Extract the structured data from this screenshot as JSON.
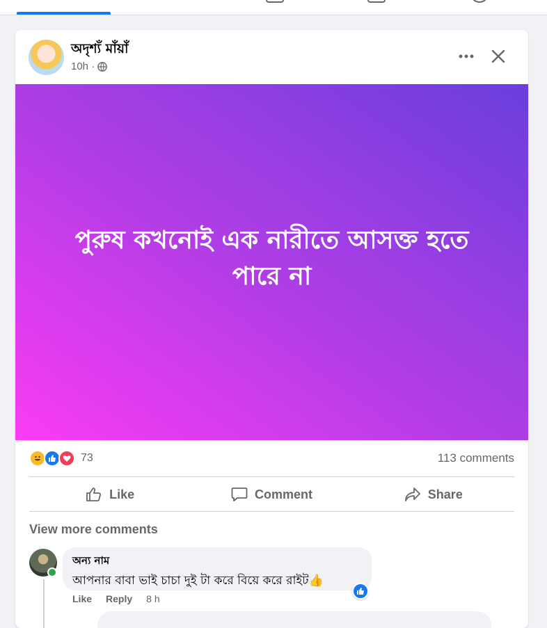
{
  "post": {
    "author": "অদৃশ্যঁ মাঁয়াঁ",
    "time": "10h ·",
    "privacy_icon": "globe-icon",
    "body_text": "পুরুষ কখনোই এক নারীতে আসক্ত হতে পারে না",
    "background": {
      "from": "#fb3cf4",
      "to": "#6a3fdc"
    }
  },
  "reactions": {
    "types": [
      "haha",
      "like",
      "love"
    ],
    "count": "73",
    "comments_label": "113 comments"
  },
  "actions": {
    "like": "Like",
    "comment": "Comment",
    "share": "Share"
  },
  "comments": {
    "view_more": "View more comments",
    "items": [
      {
        "author": "অন্য নাম",
        "text": "আপনার বাবা ভাই চাচা দুই টা করে বিয়ে করে রাইট👍",
        "like_label": "Like",
        "reply_label": "Reply",
        "time": "8 h"
      }
    ]
  },
  "colors": {
    "accent": "#1877f2",
    "muted_text": "#65676b",
    "love": "#f33e58",
    "haha": "#f7b928"
  }
}
